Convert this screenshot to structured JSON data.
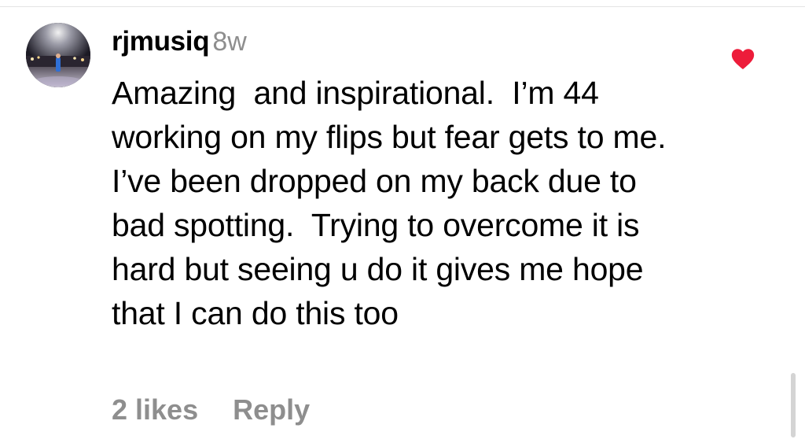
{
  "comment": {
    "avatar_icon": "user-avatar-photo",
    "username": "rjmusiq",
    "timestamp": "8w",
    "text": "Amazing  and inspirational.  I’m 44 working on my flips but fear gets to me.  I’ve been dropped on my back due to bad spotting.  Trying to overcome it is hard but seeing u do it gives me hope that I can do this too",
    "likes_label": "2 likes",
    "reply_label": "Reply",
    "liked": true,
    "heart_icon": "heart-filled-icon",
    "heart_color": "#ed1c3a"
  },
  "colors": {
    "secondary_text": "#8e8e8e",
    "primary_text": "#000000",
    "background": "#ffffff"
  }
}
